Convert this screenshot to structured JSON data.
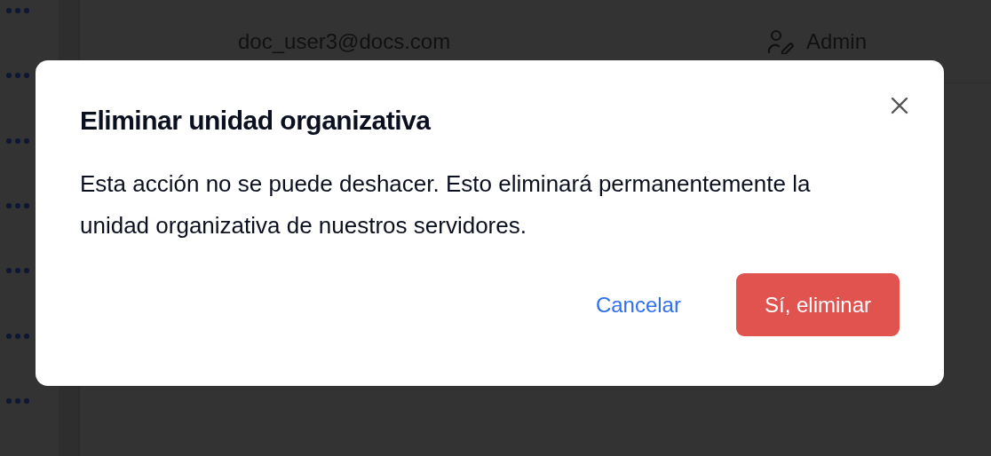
{
  "background": {
    "row": {
      "email": "doc_user3@docs.com",
      "role": "Admin"
    }
  },
  "dialog": {
    "title": "Eliminar unidad organizativa",
    "message": "Esta acción no se puede deshacer. Esto eliminará permanentemente la unidad organizativa de nuestros servidores.",
    "buttons": [
      {
        "label": "Cancelar",
        "kind": "link"
      },
      {
        "label": "Sí, eliminar",
        "kind": "danger"
      }
    ]
  }
}
